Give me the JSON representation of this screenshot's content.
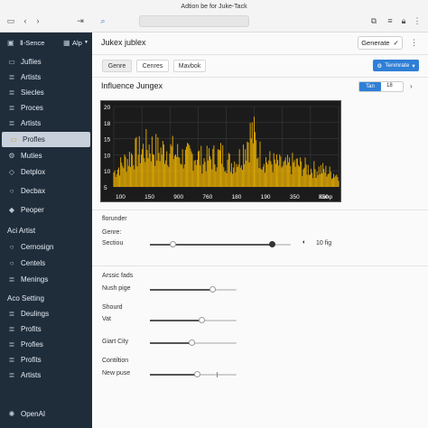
{
  "window": {
    "title": "Adtion be for Juke-Tack"
  },
  "sidebar": {
    "header": {
      "label": "Ⅱ-Sence",
      "menu": "Alp"
    },
    "items": [
      {
        "label": "Juflies",
        "icon": "folder-icon"
      },
      {
        "label": "Artists",
        "icon": "list-icon"
      },
      {
        "label": "Siecles",
        "icon": "list-icon"
      },
      {
        "label": "Proces",
        "icon": "list-icon"
      },
      {
        "label": "Artists",
        "icon": "list-icon"
      },
      {
        "label": "Profles",
        "icon": "folder-icon",
        "active": true
      },
      {
        "label": "Muties",
        "icon": "gear-icon"
      },
      {
        "label": "Detplox",
        "icon": "tag-icon"
      },
      {
        "label": "Decbax",
        "icon": "circle-icon"
      },
      {
        "label": "Peoper",
        "icon": "pin-icon"
      }
    ],
    "group1": {
      "label": "Aci Artist"
    },
    "group1_items": [
      {
        "label": "Cernosign",
        "icon": "circle-icon"
      },
      {
        "label": "Centels",
        "icon": "circle-icon"
      },
      {
        "label": "Menings",
        "icon": "list-icon"
      }
    ],
    "group2": {
      "label": "Aco Setting"
    },
    "group2_items": [
      {
        "label": "Deulings",
        "icon": "list-icon"
      },
      {
        "label": "Profits",
        "icon": "list-icon"
      },
      {
        "label": "Profies",
        "icon": "list-icon"
      },
      {
        "label": "Profits",
        "icon": "list-icon"
      },
      {
        "label": "Artists",
        "icon": "list-icon"
      }
    ],
    "footer": {
      "label": "OpenAI"
    }
  },
  "main": {
    "title": "Jukex jublex",
    "generate_label": "Generate",
    "tabs": [
      "Genre",
      "Cenres",
      "Mavbok"
    ],
    "template_label": "Tenmrate",
    "section_title": "Influence Jungex",
    "zoom": {
      "button": "Tan",
      "value": "18"
    }
  },
  "controls": {
    "header": "florunder",
    "genre": "Genre:",
    "section_label": "Sectiou",
    "section_value": "10 fig",
    "group_a": "Arssic fads",
    "nush": "Nush pige",
    "should": "Shourd",
    "vat": "Vat",
    "giant": "Giart City",
    "condition": "Contiltion",
    "newpuse": "New puse"
  },
  "levels": {
    "section": 0.87,
    "nush": 0.73,
    "vat": 0.6,
    "giant": 0.49,
    "newpuse": 0.55
  },
  "chart_data": {
    "type": "area",
    "x_ticks": [
      "100",
      "150",
      "900",
      "760",
      "180",
      "190",
      "350",
      "350"
    ],
    "x_unit": "Konp",
    "y_ticks": [
      "20",
      "18",
      "15",
      "10",
      "10",
      "5"
    ],
    "series_color": "#f5b800",
    "grid": true,
    "envelope": [
      [
        0,
        5
      ],
      [
        0.04,
        8
      ],
      [
        0.08,
        11
      ],
      [
        0.12,
        12
      ],
      [
        0.16,
        14
      ],
      [
        0.2,
        12
      ],
      [
        0.24,
        13
      ],
      [
        0.28,
        11
      ],
      [
        0.32,
        10
      ],
      [
        0.36,
        11
      ],
      [
        0.4,
        9
      ],
      [
        0.44,
        10
      ],
      [
        0.48,
        11
      ],
      [
        0.52,
        8
      ],
      [
        0.56,
        10
      ],
      [
        0.6,
        17
      ],
      [
        0.62,
        18
      ],
      [
        0.64,
        12
      ],
      [
        0.68,
        9
      ],
      [
        0.72,
        8
      ],
      [
        0.76,
        7
      ],
      [
        0.8,
        8
      ],
      [
        0.84,
        7
      ],
      [
        0.88,
        6
      ],
      [
        0.92,
        6
      ],
      [
        0.96,
        5
      ],
      [
        1,
        4
      ]
    ]
  }
}
